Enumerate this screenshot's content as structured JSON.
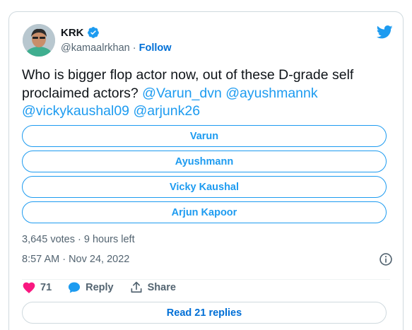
{
  "author": {
    "name": "KRK",
    "handle": "@kamaalrkhan",
    "separator": " · ",
    "follow_label": "Follow"
  },
  "tweet": {
    "text": "Who is bigger flop actor now, out of these D-grade self proclaimed actors?",
    "mentions": [
      "@Varun_dvn",
      "@ayushmannk",
      "@vickykaushal09",
      "@arjunk26"
    ]
  },
  "poll": {
    "options": [
      "Varun",
      "Ayushmann",
      "Vicky Kaushal",
      "Arjun Kapoor"
    ],
    "meta": "3,645 votes · 9 hours left"
  },
  "timestamp": "8:57 AM · Nov 24, 2022",
  "actions": {
    "like_count": "71",
    "reply_label": "Reply",
    "share_label": "Share"
  },
  "read_replies_label": "Read 21 replies",
  "colors": {
    "accent": "#1d9bf0",
    "link": "#006fd6",
    "like": "#f91880",
    "muted": "#536471"
  },
  "icons": [
    "verified-badge-icon",
    "twitter-bird-icon",
    "info-icon",
    "heart-icon",
    "reply-bubble-icon",
    "share-icon"
  ]
}
